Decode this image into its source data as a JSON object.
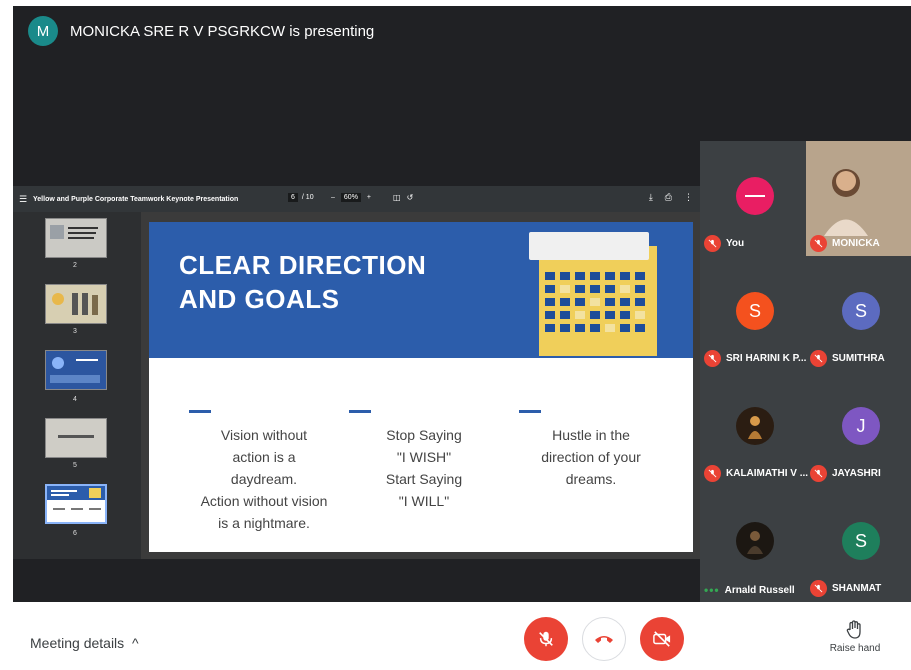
{
  "presenter": {
    "initial": "M",
    "text": "MONICKA SRE R V PSGRKCW is presenting"
  },
  "pdf": {
    "menu_icon": "menu-icon",
    "title": "Yellow and Purple Corporate Teamwork Keynote Presentation",
    "page_current": "6",
    "page_total": "/ 10",
    "zoom_minus": "–",
    "zoom_value": "60%",
    "zoom_plus": "+",
    "fit_icon": "fit-page-icon",
    "rotate_icon": "rotate-icon",
    "download_icon": "download-icon",
    "print_icon": "print-icon",
    "more_icon": "more-vert-icon",
    "thumbnails": [
      {
        "num": "2",
        "text": "Is Team Work Important for a business or not?"
      },
      {
        "num": "3",
        "text": ""
      },
      {
        "num": "4",
        "text": ""
      },
      {
        "num": "5",
        "text": ""
      },
      {
        "num": "6",
        "text": "CLEAR DIRECTION AND GOALS"
      }
    ]
  },
  "slide": {
    "title_line1": "CLEAR DIRECTION",
    "title_line2": "AND GOALS",
    "col1": [
      "Vision without",
      "action is a",
      "daydream.",
      "Action without vision",
      "is a nightmare."
    ],
    "col2": [
      "Stop Saying",
      "\"I WISH\"",
      "Start Saying",
      "\"I WILL\""
    ],
    "col3": [
      "Hustle in the",
      "direction of your",
      "dreams."
    ],
    "accent_color": "#2c5dab",
    "calendar_color": "#f0cf5a"
  },
  "participants": [
    {
      "name": "You",
      "avatar": "",
      "avatar_color": "#e91e63",
      "status": "muted"
    },
    {
      "name": "MONICKA",
      "avatar": "",
      "avatar_color": "#c9a27e",
      "status": "muted"
    },
    {
      "name": "SRI HARINI K P...",
      "avatar": "S",
      "avatar_color": "#f4511e",
      "status": "muted"
    },
    {
      "name": "SUMITHRA",
      "avatar": "S",
      "avatar_color": "#5c6bc0",
      "status": "muted"
    },
    {
      "name": "KALAIMATHI V ...",
      "avatar": "",
      "avatar_color": "#6d4c2f",
      "status": "muted"
    },
    {
      "name": "JAYASHRI",
      "avatar": "J",
      "avatar_color": "#7e57c2",
      "status": "muted"
    },
    {
      "name": "Arnald Russell",
      "avatar": "",
      "avatar_color": "#4a3b2c",
      "status": "speaking"
    },
    {
      "name": "SHANMAT",
      "avatar": "S",
      "avatar_color": "#1e7f5c",
      "status": "muted"
    }
  ],
  "controls": {
    "meeting_details": "Meeting details",
    "meeting_details_icon": "chevron-up-icon",
    "mic_icon": "mic-off-icon",
    "hangup_icon": "call-end-icon",
    "cam_icon": "videocam-off-icon",
    "raise_hand_icon": "raise-hand-icon",
    "raise_hand": "Raise hand"
  }
}
